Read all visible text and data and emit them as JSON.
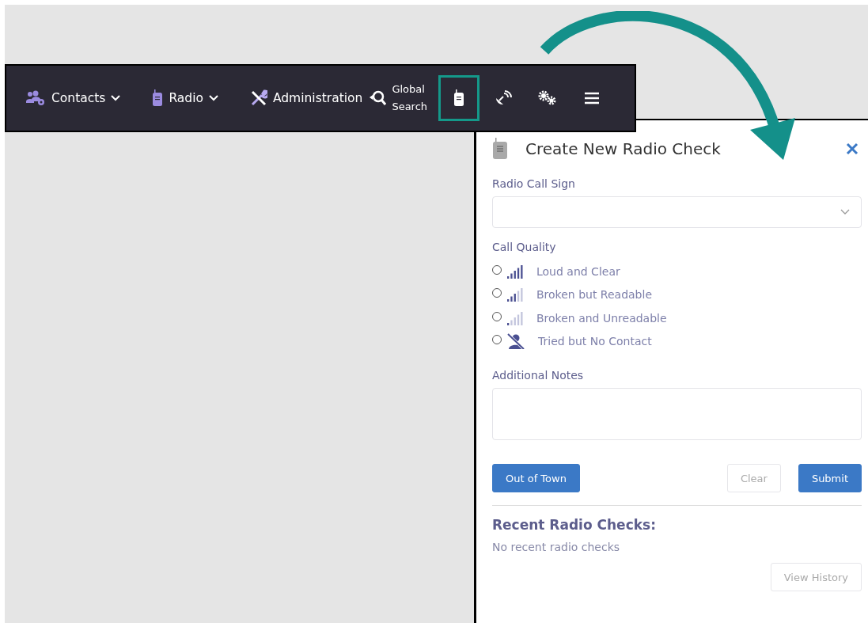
{
  "navbar": {
    "items": [
      {
        "label": "Contacts",
        "dropdown": true
      },
      {
        "label": "Radio",
        "dropdown": true
      },
      {
        "label": "Administration",
        "dropdown": false
      },
      {
        "label": "Global\nSearch",
        "dropdown": false
      }
    ],
    "icon_buttons": [
      {
        "selected": true
      },
      {
        "selected": false
      },
      {
        "selected": false
      },
      {
        "selected": false
      }
    ]
  },
  "panel": {
    "title": "Create New Radio Check",
    "call_sign": {
      "label": "Radio Call Sign"
    },
    "call_quality": {
      "label": "Call Quality",
      "options": [
        {
          "label": "Loud and Clear",
          "kind": "strong",
          "selected": false
        },
        {
          "label": "Broken but Readable",
          "kind": "medium",
          "selected": false
        },
        {
          "label": "Broken and Unreadable",
          "kind": "weak",
          "selected": false
        },
        {
          "label": "Tried but No Contact",
          "kind": "none",
          "selected": false
        }
      ]
    },
    "notes": {
      "label": "Additional Notes"
    },
    "buttons": {
      "out_of_town": "Out of Town",
      "clear": "Clear",
      "submit": "Submit"
    },
    "recent": {
      "title": "Recent Radio Checks:",
      "empty": "No recent radio checks",
      "history_button": "View History"
    }
  }
}
